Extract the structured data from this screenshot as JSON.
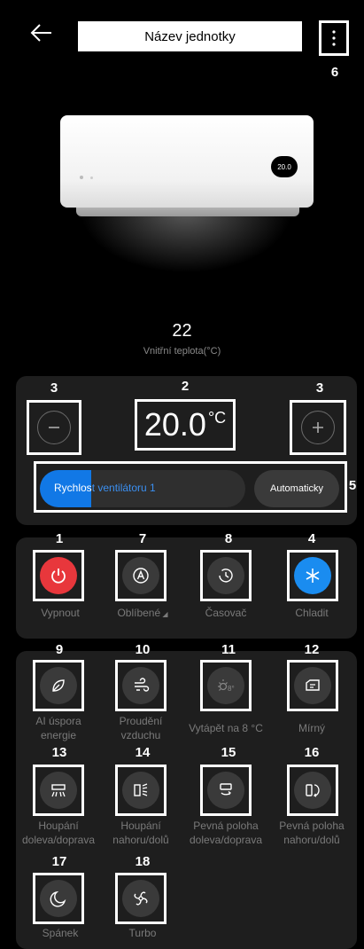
{
  "header": {
    "title": "Název jednotky",
    "menu_marker": "6"
  },
  "unit_display": "20.0",
  "indoor": {
    "value": "22",
    "label": "Vnitřní teplota(°C)"
  },
  "temperature": {
    "value": "20.0",
    "unit": "°C",
    "marker": "2",
    "minus_marker": "3",
    "plus_marker": "3"
  },
  "fan": {
    "label_part1": "Rychlos",
    "label_part2": "t ventilátoru 1",
    "auto_label": "Automaticky",
    "marker": "5",
    "level_fraction": 0.25
  },
  "main_modes": [
    {
      "marker": "1",
      "label": "Vypnout",
      "icon": "power-icon",
      "color": "#e8373c"
    },
    {
      "marker": "7",
      "label": "Oblíbené",
      "icon": "a-mode-icon"
    },
    {
      "marker": "8",
      "label": "Časovač",
      "icon": "timer-icon"
    },
    {
      "marker": "4",
      "label": "Chladit",
      "icon": "snowflake-icon",
      "color": "#1a8cf0"
    }
  ],
  "functions": [
    {
      "marker": "9",
      "label_1": "AI úspora",
      "label_2": "energie",
      "icon": "leaf-icon"
    },
    {
      "marker": "10",
      "label_1": "Proudění",
      "label_2": "vzduchu",
      "icon": "airflow-icon"
    },
    {
      "marker": "11",
      "label_1": "Vytápět na 8 °C",
      "label_2": "",
      "icon": "heat-8-icon"
    },
    {
      "marker": "12",
      "label_1": "Mírný",
      "label_2": "",
      "icon": "gentle-wind-icon"
    },
    {
      "marker": "13",
      "label_1": "Houpání",
      "label_2": "doleva/doprava",
      "icon": "swing-lr-icon"
    },
    {
      "marker": "14",
      "label_1": "Houpání",
      "label_2": "nahoru/dolů",
      "icon": "swing-ud-icon"
    },
    {
      "marker": "15",
      "label_1": "Pevná poloha",
      "label_2": "doleva/doprava",
      "icon": "fixed-lr-icon"
    },
    {
      "marker": "16",
      "label_1": "Pevná poloha",
      "label_2": "nahoru/dolů",
      "icon": "fixed-ud-icon"
    },
    {
      "marker": "17",
      "label_1": "Spánek",
      "label_2": "",
      "icon": "moon-icon"
    },
    {
      "marker": "18",
      "label_1": "Turbo",
      "label_2": "",
      "icon": "turbo-icon"
    }
  ]
}
